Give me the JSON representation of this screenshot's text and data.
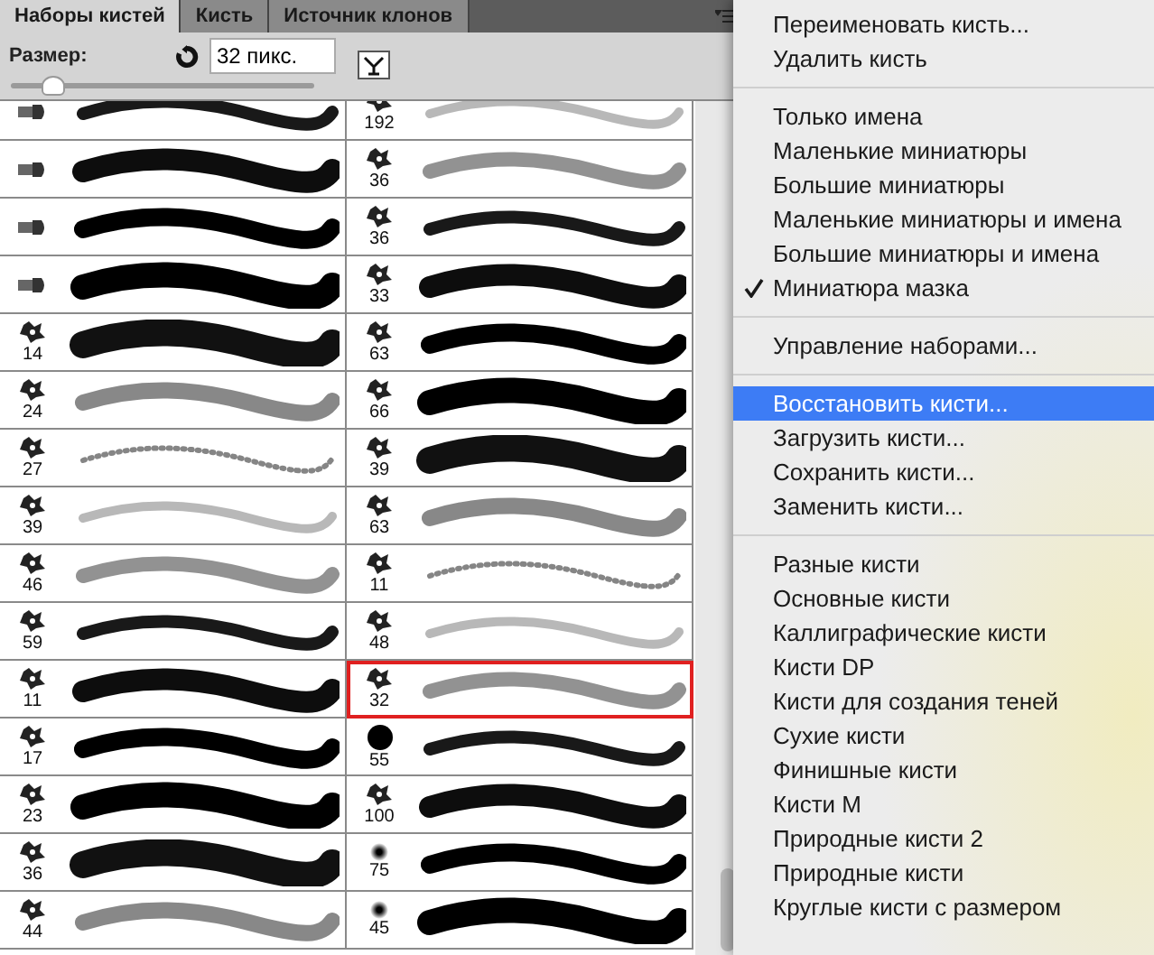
{
  "panel": {
    "tabs": [
      {
        "label": "Наборы кистей",
        "selected": true
      },
      {
        "label": "Кисть",
        "selected": false
      },
      {
        "label": "Источник клонов",
        "selected": false
      }
    ],
    "size_label": "Размер:",
    "size_value": "32 пикс.",
    "size_slider": {
      "level": 0.13
    },
    "brushes": [
      [
        {
          "kind": "bristle",
          "selected": false
        },
        {
          "kind": "sampled",
          "size": "192",
          "selected": false
        }
      ],
      [
        {
          "kind": "bristle",
          "selected": false
        },
        {
          "kind": "sampled",
          "size": "36",
          "selected": false
        }
      ],
      [
        {
          "kind": "bristle",
          "selected": false
        },
        {
          "kind": "sampled",
          "size": "36",
          "selected": false
        }
      ],
      [
        {
          "kind": "bristle",
          "selected": false
        },
        {
          "kind": "sampled",
          "size": "33",
          "selected": false
        }
      ],
      [
        {
          "kind": "sampled",
          "size": "14",
          "selected": false
        },
        {
          "kind": "sampled",
          "size": "63",
          "selected": false
        }
      ],
      [
        {
          "kind": "sampled",
          "size": "24",
          "selected": false
        },
        {
          "kind": "sampled",
          "size": "66",
          "selected": false
        }
      ],
      [
        {
          "kind": "sampled",
          "size": "27",
          "selected": false
        },
        {
          "kind": "sampled",
          "size": "39",
          "selected": false
        }
      ],
      [
        {
          "kind": "sampled",
          "size": "39",
          "selected": false
        },
        {
          "kind": "sampled",
          "size": "63",
          "selected": false
        }
      ],
      [
        {
          "kind": "sampled",
          "size": "46",
          "selected": false
        },
        {
          "kind": "sampled",
          "size": "11",
          "selected": false
        }
      ],
      [
        {
          "kind": "sampled",
          "size": "59",
          "selected": false
        },
        {
          "kind": "sampled",
          "size": "48",
          "selected": false
        }
      ],
      [
        {
          "kind": "sampled",
          "size": "11",
          "selected": false
        },
        {
          "kind": "sampled",
          "size": "32",
          "selected": true
        }
      ],
      [
        {
          "kind": "sampled",
          "size": "17",
          "selected": false
        },
        {
          "kind": "round",
          "size": "55",
          "selected": false
        }
      ],
      [
        {
          "kind": "sampled",
          "size": "23",
          "selected": false
        },
        {
          "kind": "sampled",
          "size": "100",
          "selected": false
        }
      ],
      [
        {
          "kind": "sampled",
          "size": "36",
          "selected": false
        },
        {
          "kind": "soft",
          "size": "75",
          "selected": false
        }
      ],
      [
        {
          "kind": "sampled",
          "size": "44",
          "selected": false
        },
        {
          "kind": "soft",
          "size": "45",
          "selected": false
        }
      ]
    ]
  },
  "menu": {
    "sections": [
      [
        {
          "label": "Переименовать кисть...",
          "checked": false,
          "highlighted": false
        },
        {
          "label": "Удалить кисть",
          "checked": false,
          "highlighted": false
        }
      ],
      [
        {
          "label": "Только имена",
          "checked": false,
          "highlighted": false
        },
        {
          "label": "Маленькие миниатюры",
          "checked": false,
          "highlighted": false
        },
        {
          "label": "Большие миниатюры",
          "checked": false,
          "highlighted": false
        },
        {
          "label": "Маленькие миниатюры и имена",
          "checked": false,
          "highlighted": false
        },
        {
          "label": "Большие миниатюры и имена",
          "checked": false,
          "highlighted": false
        },
        {
          "label": "Миниатюра мазка",
          "checked": true,
          "highlighted": false
        }
      ],
      [
        {
          "label": "Управление наборами...",
          "checked": false,
          "highlighted": false
        }
      ],
      [
        {
          "label": "Восстановить кисти...",
          "checked": false,
          "highlighted": true
        },
        {
          "label": "Загрузить кисти...",
          "checked": false,
          "highlighted": false
        },
        {
          "label": "Сохранить кисти...",
          "checked": false,
          "highlighted": false
        },
        {
          "label": "Заменить кисти...",
          "checked": false,
          "highlighted": false
        }
      ],
      [
        {
          "label": "Разные кисти",
          "checked": false,
          "highlighted": false
        },
        {
          "label": "Основные кисти",
          "checked": false,
          "highlighted": false
        },
        {
          "label": "Каллиграфические кисти",
          "checked": false,
          "highlighted": false
        },
        {
          "label": "Кисти DP",
          "checked": false,
          "highlighted": false
        },
        {
          "label": "Кисти для создания теней",
          "checked": false,
          "highlighted": false
        },
        {
          "label": "Сухие кисти",
          "checked": false,
          "highlighted": false
        },
        {
          "label": "Финишные кисти",
          "checked": false,
          "highlighted": false
        },
        {
          "label": "Кисти M",
          "checked": false,
          "highlighted": false
        },
        {
          "label": "Природные кисти 2",
          "checked": false,
          "highlighted": false
        },
        {
          "label": "Природные кисти",
          "checked": false,
          "highlighted": false
        },
        {
          "label": "Круглые кисти с размером",
          "checked": false,
          "highlighted": false
        }
      ]
    ]
  }
}
